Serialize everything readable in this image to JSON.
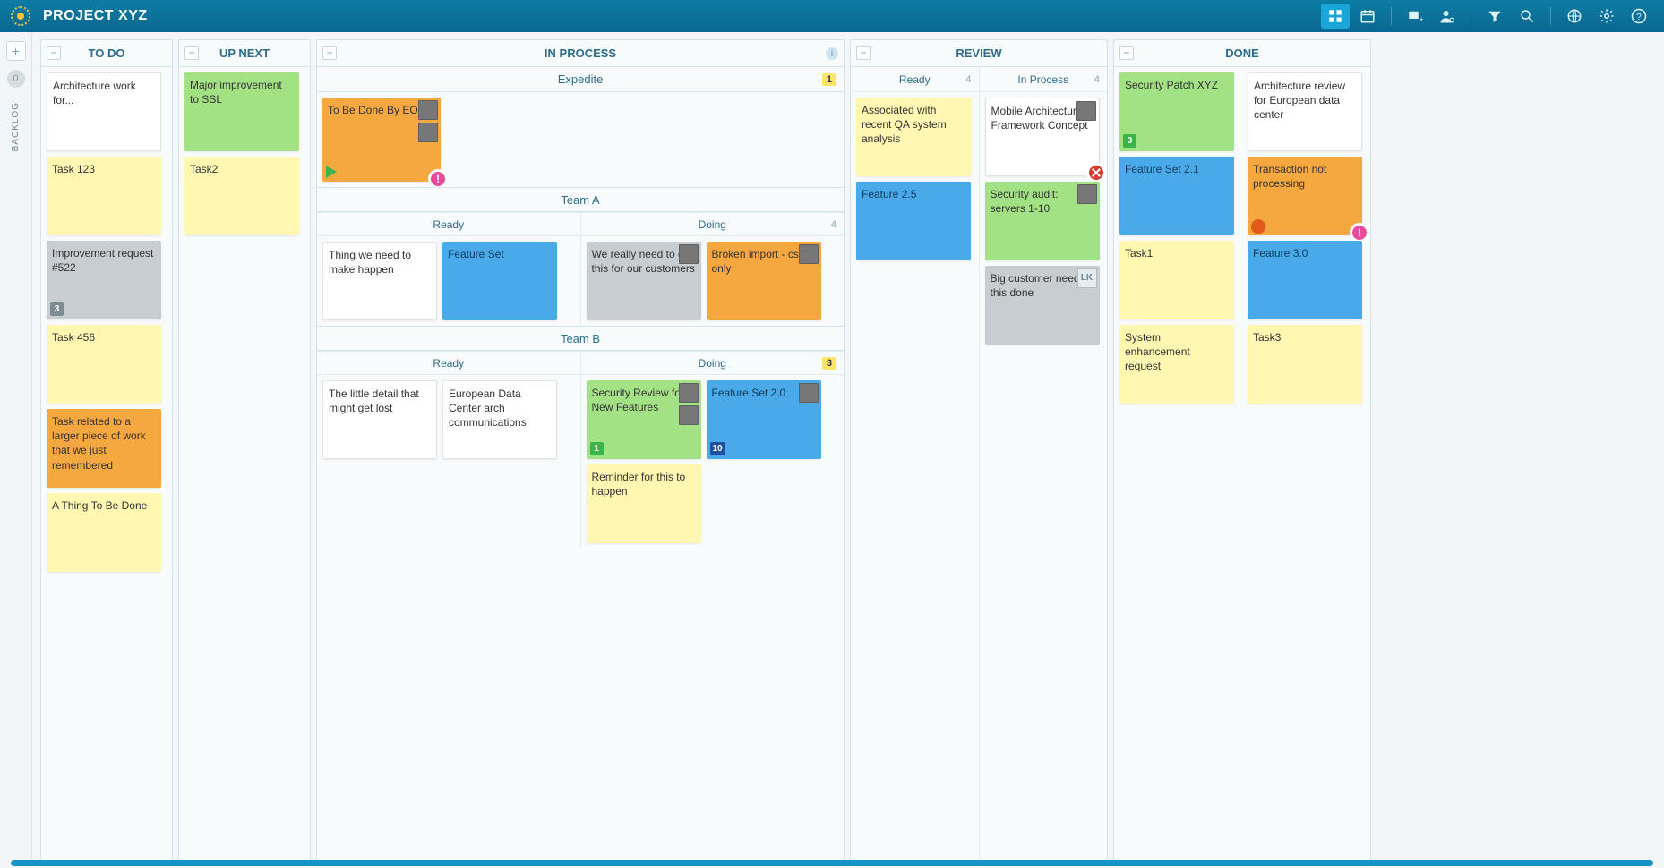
{
  "header": {
    "project_title": "PROJECT XYZ"
  },
  "siderail": {
    "add_label": "+",
    "count": "0",
    "backlog_label": "BACKLOG"
  },
  "columns": {
    "todo": {
      "title": "TO DO",
      "cards": [
        {
          "text": "Architecture work for...",
          "color": "white"
        },
        {
          "text": "Task 123",
          "color": "yellow"
        },
        {
          "text": "Improvement request #522",
          "color": "grey",
          "badge": "3",
          "badge_color": "darkgrey"
        },
        {
          "text": "Task 456",
          "color": "yellow"
        },
        {
          "text": "Task related to a larger piece of work that we just remembered",
          "color": "orange"
        },
        {
          "text": "A Thing To Be Done",
          "color": "yellow"
        }
      ]
    },
    "upnext": {
      "title": "UP NEXT",
      "cards": [
        {
          "text": "Major improvement to SSL",
          "color": "green"
        },
        {
          "text": "Task2",
          "color": "yellow"
        }
      ]
    },
    "inprocess": {
      "title": "IN PROCESS",
      "expedite": {
        "title": "Expedite",
        "badge": "1",
        "cards": [
          {
            "text": "To Be Done By EOD!",
            "color": "orange",
            "avatars": 2,
            "arrow": true,
            "alert": "pink"
          }
        ]
      },
      "teamA": {
        "title": "Team A",
        "ready": {
          "title": "Ready",
          "cards": [
            {
              "text": "Thing we need to make happen",
              "color": "white"
            },
            {
              "text": "Feature Set",
              "color": "blue"
            }
          ]
        },
        "doing": {
          "title": "Doing",
          "count": "4",
          "cards": [
            {
              "text": "We really need to do this for our customers",
              "color": "grey",
              "avatars": 1
            },
            {
              "text": "Broken import - csv only",
              "color": "orange",
              "avatars": 1
            }
          ]
        }
      },
      "teamB": {
        "title": "Team B",
        "ready": {
          "title": "Ready",
          "cards": [
            {
              "text": "The little detail that might get lost",
              "color": "white"
            },
            {
              "text": "European Data Center arch communications",
              "color": "white"
            }
          ]
        },
        "doing": {
          "title": "Doing",
          "count": "3",
          "cards": [
            {
              "text": "Security Review for New Features",
              "color": "green",
              "avatars": 2,
              "badge": "1",
              "badge_color": "green"
            },
            {
              "text": "Feature Set 2.0",
              "color": "blue",
              "avatars": 1,
              "badge": "10",
              "badge_color": "navy"
            },
            {
              "text": "Reminder for this to happen",
              "color": "yellow"
            }
          ]
        }
      }
    },
    "review": {
      "title": "REVIEW",
      "ready": {
        "title": "Ready",
        "count": "4",
        "cards": [
          {
            "text": "Associated with recent QA system analysis",
            "color": "yellow"
          },
          {
            "text": "Feature 2.5",
            "color": "blue"
          }
        ]
      },
      "inprocess": {
        "title": "In Process",
        "count": "4",
        "cards": [
          {
            "text": "Mobile Architecture Framework Concept",
            "color": "white",
            "avatars": 1,
            "alert": "red"
          },
          {
            "text": "Security audit: servers 1-10",
            "color": "green",
            "avatars": 1
          },
          {
            "text": "Big customer needs this done",
            "color": "grey",
            "avatar_initials": "LK"
          }
        ]
      }
    },
    "done": {
      "title": "DONE",
      "left": [
        {
          "text": "Security Patch XYZ",
          "color": "green",
          "badge": "3",
          "badge_color": "green"
        },
        {
          "text": "Feature Set 2.1",
          "color": "blue"
        },
        {
          "text": "Task1",
          "color": "yellow"
        },
        {
          "text": "System enhancement request",
          "color": "yellow"
        }
      ],
      "right": [
        {
          "text": "Architecture review for European data center",
          "color": "white"
        },
        {
          "text": "Transaction not processing",
          "color": "orange",
          "bug": true,
          "alert": "pink"
        },
        {
          "text": "Feature 3.0",
          "color": "blue"
        },
        {
          "text": "Task3",
          "color": "yellow"
        }
      ]
    }
  }
}
